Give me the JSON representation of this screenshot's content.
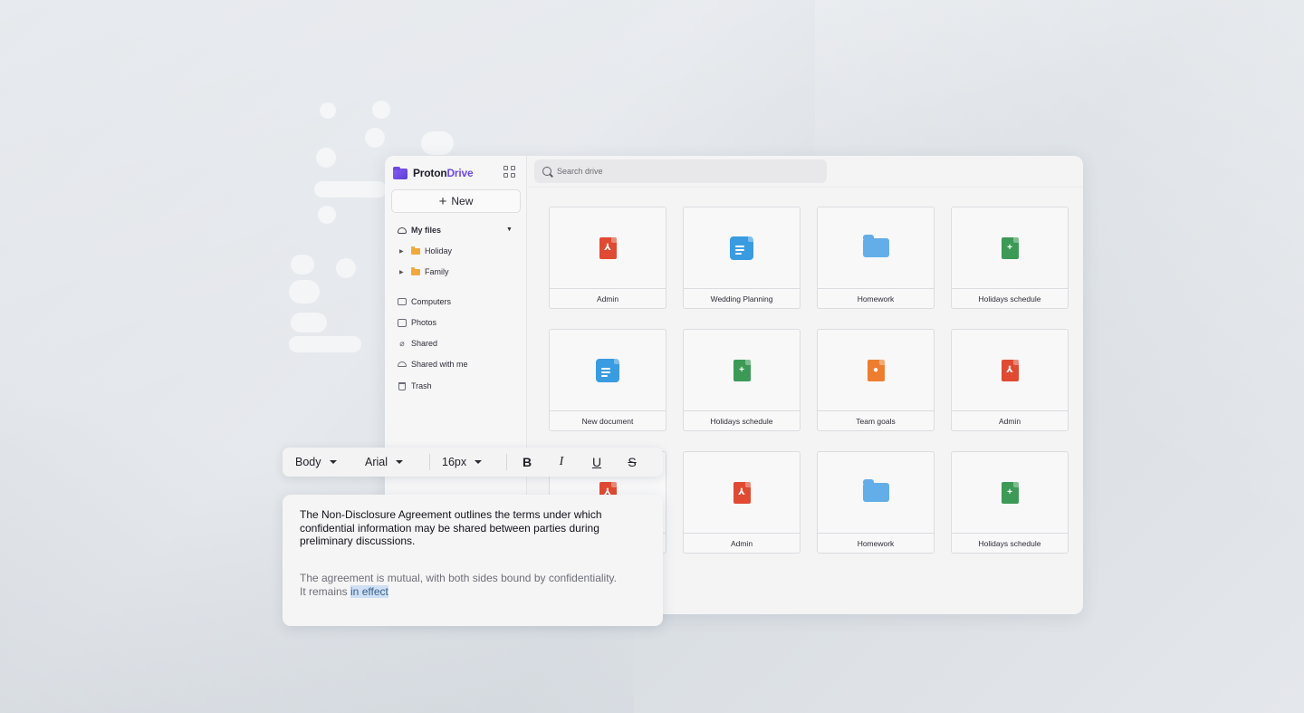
{
  "app": {
    "brand_prefix": "Proton",
    "brand_accent": "Drive",
    "brand_color": "#6d4ae2"
  },
  "sidebar": {
    "new_label": "New",
    "my_files_label": "My files",
    "folders": [
      {
        "label": "Holiday",
        "icon": "folder-icon"
      },
      {
        "label": "Family",
        "icon": "folder-icon"
      }
    ],
    "items": [
      {
        "label": "Computers",
        "icon": "monitor-icon"
      },
      {
        "label": "Photos",
        "icon": "image-icon"
      },
      {
        "label": "Shared",
        "icon": "link-icon"
      },
      {
        "label": "Shared with me",
        "icon": "users-icon"
      },
      {
        "label": "Trash",
        "icon": "trash-icon"
      }
    ]
  },
  "search": {
    "placeholder": "Search drive"
  },
  "files": [
    {
      "label": "Admin",
      "type": "pdf"
    },
    {
      "label": "Wedding Planning",
      "type": "doc"
    },
    {
      "label": "Homework",
      "type": "folder"
    },
    {
      "label": "Holidays schedule",
      "type": "sheet"
    },
    {
      "label": "New document",
      "type": "doc"
    },
    {
      "label": "Holidays schedule",
      "type": "sheet"
    },
    {
      "label": "Team goals",
      "type": "slide"
    },
    {
      "label": "Admin",
      "type": "pdf"
    },
    {
      "label": "",
      "type": "pdf"
    },
    {
      "label": "Admin",
      "type": "pdf"
    },
    {
      "label": "Homework",
      "type": "folder"
    },
    {
      "label": "Holidays schedule",
      "type": "sheet"
    }
  ],
  "toolbar": {
    "style_value": "Body",
    "font_value": "Arial",
    "size_value": "16px",
    "bold_label": "B",
    "italic_label": "I",
    "underline_label": "U",
    "strike_label": "S"
  },
  "editor": {
    "paragraph1": "The Non-Disclosure Agreement outlines the terms under which confidential information may be shared between parties during preliminary discussions.",
    "paragraph2_line1": "The agreement is mutual, with both sides bound by confidentiality.",
    "paragraph2_line2_prefix": "It remains ",
    "paragraph2_highlight": "in effect"
  },
  "colors": {
    "pdf": "#e04a32",
    "doc": "#3a9ce0",
    "sheet": "#3c9a56",
    "slide": "#ef7d2f",
    "folder": "#63aee8",
    "selection": "#cfe0f4"
  }
}
